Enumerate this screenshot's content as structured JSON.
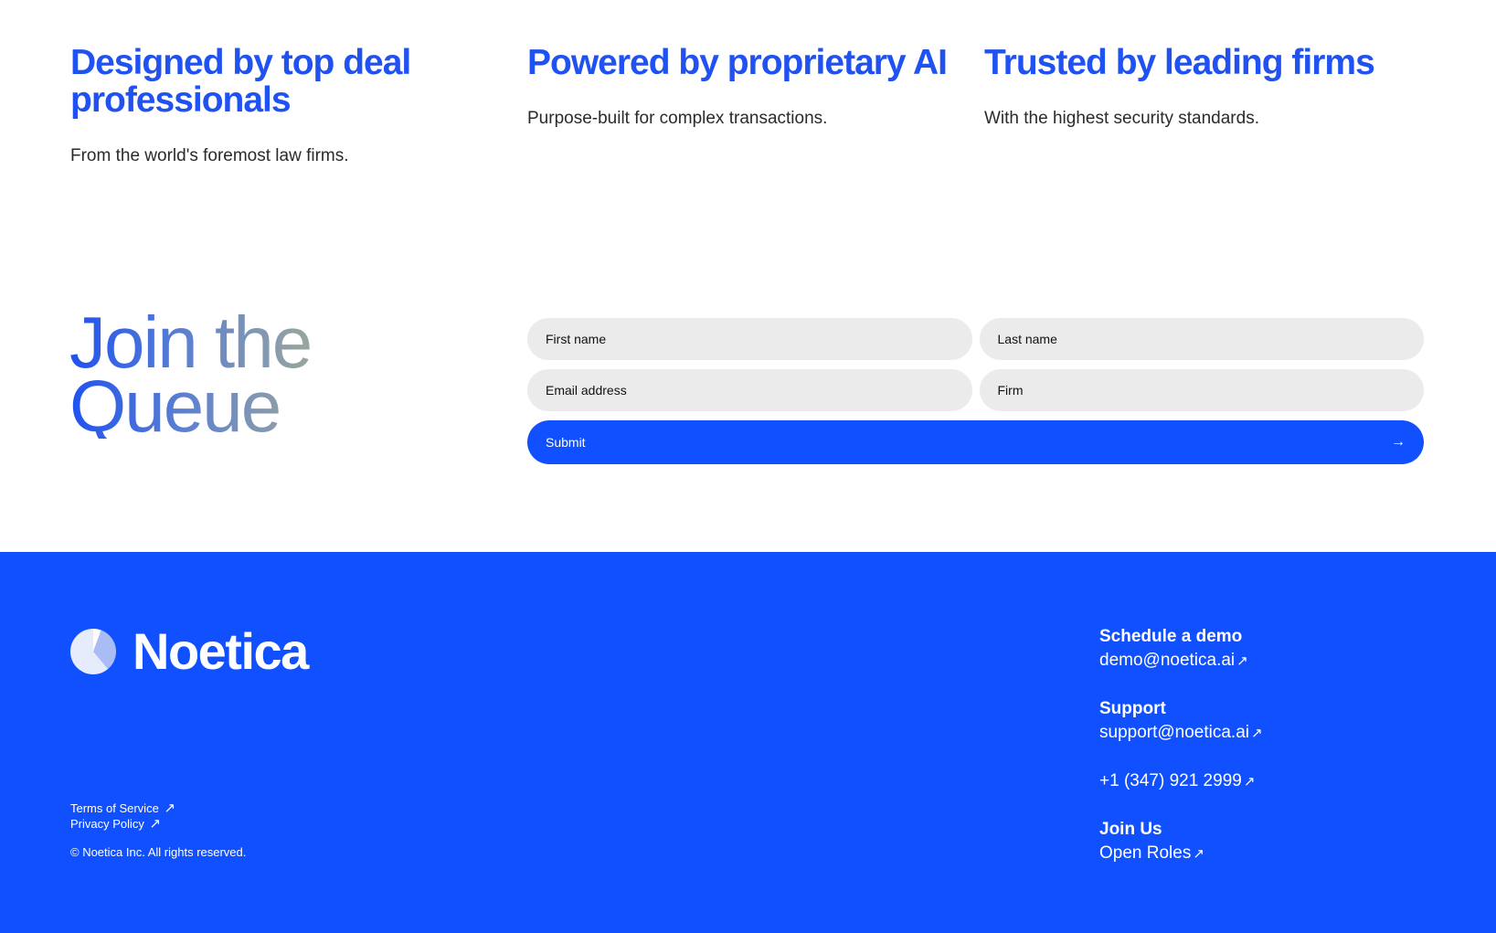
{
  "features": [
    {
      "title": "Designed by top deal professionals",
      "text": "From the world's foremost law firms."
    },
    {
      "title": "Powered by proprietary AI",
      "text": "Purpose-built for complex transactions."
    },
    {
      "title": "Trusted by leading firms",
      "text": "With the highest security standards."
    }
  ],
  "join": {
    "line1": "Join the",
    "line2": "Queue"
  },
  "form": {
    "first_name_placeholder": "First name",
    "last_name_placeholder": "Last name",
    "email_placeholder": "Email address",
    "firm_placeholder": "Firm",
    "submit_label": "Submit",
    "submit_icon": "→"
  },
  "footer": {
    "brand": "Noetica",
    "terms": "Terms of Service",
    "privacy": "Privacy Policy",
    "copyright": "© Noetica Inc. All rights reserved.",
    "external_icon": "↗",
    "demo_heading": "Schedule a demo",
    "demo_email": "demo@noetica.ai",
    "support_heading": "Support",
    "support_email": "support@noetica.ai",
    "phone": "+1 (347) 921 2999",
    "join_heading": "Join Us",
    "open_roles": "Open Roles"
  },
  "colors": {
    "brand_blue": "#1150ff",
    "heading_blue": "#1f52f0",
    "field_bg": "#ebebeb"
  }
}
